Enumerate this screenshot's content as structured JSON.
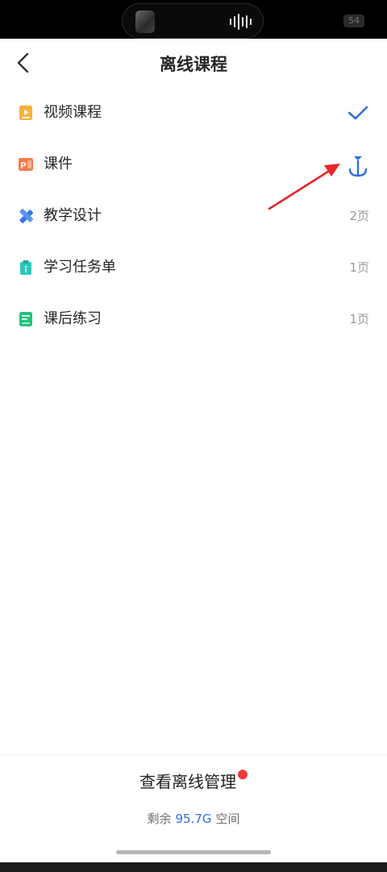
{
  "status": {
    "battery": "54"
  },
  "header": {
    "title": "离线课程"
  },
  "items": [
    {
      "label": "视频课程",
      "state": "downloaded",
      "icon": "video-icon",
      "color": "#f5b23c"
    },
    {
      "label": "课件",
      "state": "downloadable",
      "icon": "ppt-icon",
      "color": "#f27d4c"
    },
    {
      "label": "教学设计",
      "pages": "2页",
      "icon": "design-icon",
      "color": "#2f76e6"
    },
    {
      "label": "学习任务单",
      "pages": "1页",
      "icon": "clipboard-icon",
      "color": "#2bc9b9"
    },
    {
      "label": "课后练习",
      "pages": "1页",
      "icon": "notebook-icon",
      "color": "#21c47b"
    }
  ],
  "footer": {
    "manage_label": "查看离线管理",
    "storage_prefix": "剩余",
    "storage_value": "95.7G",
    "storage_suffix": "空间"
  },
  "colors": {
    "accent": "#2f6fdc",
    "annotation": "#e8262b",
    "badge": "#ef3b3b"
  }
}
